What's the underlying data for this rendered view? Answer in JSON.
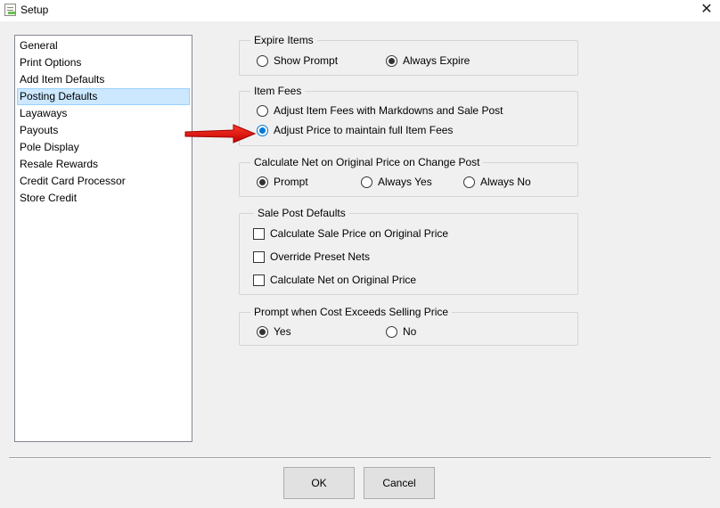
{
  "window": {
    "title": "Setup",
    "close_glyph": "✕"
  },
  "nav": {
    "items": [
      {
        "label": "General"
      },
      {
        "label": "Print Options"
      },
      {
        "label": "Add Item Defaults"
      },
      {
        "label": "Posting Defaults",
        "selected": true
      },
      {
        "label": "Layaways"
      },
      {
        "label": "Payouts"
      },
      {
        "label": "Pole Display"
      },
      {
        "label": "Resale Rewards"
      },
      {
        "label": "Credit Card Processor"
      },
      {
        "label": "Store Credit"
      }
    ]
  },
  "groups": {
    "expire_items": {
      "title": "Expire Items",
      "options": [
        {
          "label": "Show Prompt",
          "checked": false
        },
        {
          "label": "Always Expire",
          "checked": true
        }
      ]
    },
    "item_fees": {
      "title": "Item Fees",
      "options": [
        {
          "label": "Adjust Item Fees with Markdowns and Sale Post",
          "checked": false
        },
        {
          "label": "Adjust Price to maintain full Item Fees",
          "checked": true
        }
      ]
    },
    "calculate_net": {
      "title": "Calculate Net on Original Price on Change Post",
      "options": [
        {
          "label": "Prompt",
          "checked": true
        },
        {
          "label": "Always Yes",
          "checked": false
        },
        {
          "label": "Always No",
          "checked": false
        }
      ]
    },
    "sale_post_defaults": {
      "title": "Sale Post Defaults",
      "options": [
        {
          "label": "Calculate Sale Price on Original Price",
          "checked": false
        },
        {
          "label": "Override Preset Nets",
          "checked": false
        },
        {
          "label": "Calculate Net on Original Price",
          "checked": false
        }
      ]
    },
    "prompt_cost": {
      "title": "Prompt when Cost Exceeds Selling Price",
      "options": [
        {
          "label": "Yes",
          "checked": true
        },
        {
          "label": "No",
          "checked": false
        }
      ]
    }
  },
  "buttons": {
    "ok": "OK",
    "cancel": "Cancel"
  },
  "colors": {
    "accent": "#0078d7",
    "arrow": "#e00000",
    "selection": "#cce8ff"
  },
  "icons": {
    "app": "setup-app-icon",
    "arrow": "red-arrow-annotation"
  }
}
